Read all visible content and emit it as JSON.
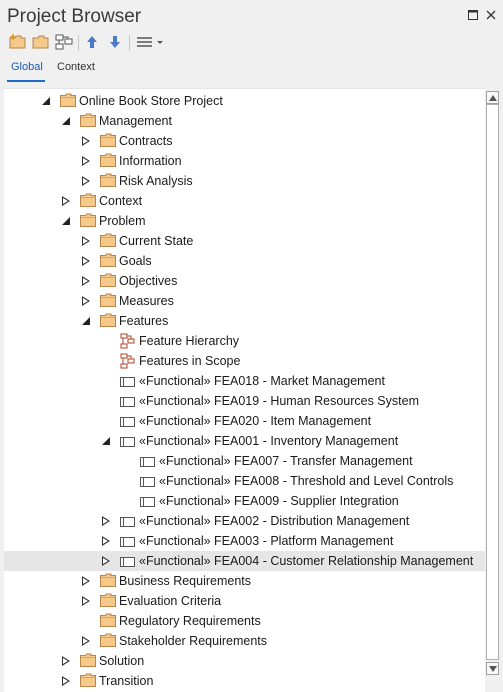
{
  "window": {
    "title": "Project Browser"
  },
  "tabs": [
    {
      "label": "Global",
      "active": true
    },
    {
      "label": "Context",
      "active": false
    }
  ],
  "tree": {
    "rows": [
      {
        "label": "Online Book Store Project",
        "level": 2,
        "toggle": "expanded",
        "icon": "folder"
      },
      {
        "label": "Management",
        "level": 3,
        "toggle": "expanded",
        "icon": "folder"
      },
      {
        "label": "Contracts",
        "level": 4,
        "toggle": "collapsed",
        "icon": "folder"
      },
      {
        "label": "Information",
        "level": 4,
        "toggle": "collapsed",
        "icon": "folder"
      },
      {
        "label": "Risk Analysis",
        "level": 4,
        "toggle": "collapsed",
        "icon": "folder"
      },
      {
        "label": "Context",
        "level": 3,
        "toggle": "collapsed",
        "icon": "folder"
      },
      {
        "label": "Problem",
        "level": 3,
        "toggle": "expanded",
        "icon": "folder"
      },
      {
        "label": "Current State",
        "level": 4,
        "toggle": "collapsed",
        "icon": "folder"
      },
      {
        "label": "Goals",
        "level": 4,
        "toggle": "collapsed",
        "icon": "folder"
      },
      {
        "label": "Objectives",
        "level": 4,
        "toggle": "collapsed",
        "icon": "folder"
      },
      {
        "label": "Measures",
        "level": 4,
        "toggle": "collapsed",
        "icon": "folder"
      },
      {
        "label": "Features",
        "level": 4,
        "toggle": "expanded",
        "icon": "folder"
      },
      {
        "label": "Feature Hierarchy",
        "level": 5,
        "toggle": "none",
        "icon": "diagram"
      },
      {
        "label": "Features in Scope",
        "level": 5,
        "toggle": "none",
        "icon": "diagram"
      },
      {
        "label": "«Functional» FEA018 - Market Management",
        "level": 5,
        "toggle": "none",
        "icon": "feature"
      },
      {
        "label": "«Functional» FEA019 - Human Resources System",
        "level": 5,
        "toggle": "none",
        "icon": "feature"
      },
      {
        "label": "«Functional» FEA020 - Item Management",
        "level": 5,
        "toggle": "none",
        "icon": "feature"
      },
      {
        "label": "«Functional» FEA001 - Inventory Management",
        "level": 5,
        "toggle": "expanded",
        "icon": "feature"
      },
      {
        "label": "«Functional» FEA007 - Transfer Management",
        "level": 6,
        "toggle": "none",
        "icon": "feature"
      },
      {
        "label": "«Functional» FEA008 - Threshold and Level Controls",
        "level": 6,
        "toggle": "none",
        "icon": "feature"
      },
      {
        "label": "«Functional» FEA009 - Supplier Integration",
        "level": 6,
        "toggle": "none",
        "icon": "feature"
      },
      {
        "label": "«Functional» FEA002 - Distribution Management",
        "level": 5,
        "toggle": "collapsed",
        "icon": "feature"
      },
      {
        "label": "«Functional» FEA003 - Platform Management",
        "level": 5,
        "toggle": "collapsed",
        "icon": "feature"
      },
      {
        "label": "«Functional» FEA004 - Customer Relationship Management",
        "level": 5,
        "toggle": "collapsed",
        "icon": "feature",
        "selected": true
      },
      {
        "label": "Business Requirements",
        "level": 4,
        "toggle": "collapsed",
        "icon": "folder"
      },
      {
        "label": "Evaluation Criteria",
        "level": 4,
        "toggle": "collapsed",
        "icon": "folder"
      },
      {
        "label": "Regulatory Requirements",
        "level": 4,
        "toggle": "none",
        "icon": "folder"
      },
      {
        "label": "Stakeholder Requirements",
        "level": 4,
        "toggle": "collapsed",
        "icon": "folder"
      },
      {
        "label": "Solution",
        "level": 3,
        "toggle": "collapsed",
        "icon": "folder"
      },
      {
        "label": "Transition",
        "level": 3,
        "toggle": "collapsed",
        "icon": "folder"
      }
    ]
  },
  "colors": {
    "folder": "#f5c98a",
    "folder_border": "#b8844a",
    "accent": "#1e6cc8",
    "selected_row": "#e6e6e6"
  }
}
